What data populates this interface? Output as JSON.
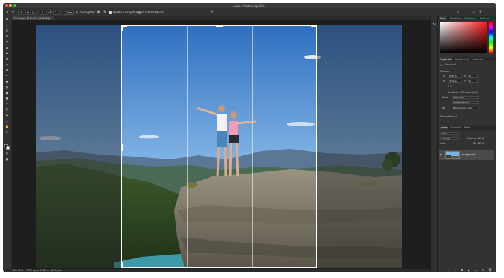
{
  "window": {
    "title": "Adobe Photoshop 2021"
  },
  "options_bar": {
    "ratio_value": "4 : 3 (4 : 5)",
    "ratio_field_1": "4",
    "ratio_field_2": "3",
    "clear_label": "Clear",
    "straighten_label": "Straighten",
    "delete_cropped_pixels_label": "Delete Cropped Pixels",
    "content_aware_label": "Content-Aware",
    "delete_cropped_checked": true,
    "content_aware_checked": false
  },
  "document": {
    "tab_label": "Photo.jpg @ 66.7% (RGB/8#) *",
    "zoom": "66.67%",
    "dimensions": "5997 px x 3572 px (300 ppi)"
  },
  "panels": {
    "color_tabs": [
      "Color",
      "Swatches",
      "Gradients",
      "Patterns"
    ],
    "properties_tabs": [
      "Properties",
      "Adjustments",
      "Libraries"
    ],
    "properties_doc_label": "Document",
    "canvas_section": "Canvas",
    "canvas_w": "5997 px",
    "canvas_h": "3572 px",
    "canvas_x": "0",
    "canvas_y": "0",
    "resolution": "Resolution: 300 pixels/inch",
    "mode_label": "Mode",
    "mode_value": "RGB Color",
    "bit_depth": "8 Bits/Channel",
    "fill_label": "Fill",
    "fill_value": "Background Color",
    "rulers_section": "Rulers & Grids",
    "layers_tabs": [
      "Layers",
      "Channels",
      "Paths"
    ],
    "layers_kind": "Kind",
    "layers_blend": "Normal",
    "layers_opacity": "Opacity: 100%",
    "layers_lock": "Lock:",
    "layers_fill": "Fill: 100%",
    "layer_name": "Background"
  },
  "icons": {
    "home": "home-icon",
    "crop_tool": "crop-icon",
    "reset": "reset-icon",
    "search": "search-icon",
    "workspace": "workspace-icon",
    "share": "share-icon"
  },
  "colors": {
    "ui_bg": "#2b2b2b",
    "panel_bg": "#323232",
    "canvas_bg": "#1e1e1e",
    "crop_border": "#ffffff"
  }
}
